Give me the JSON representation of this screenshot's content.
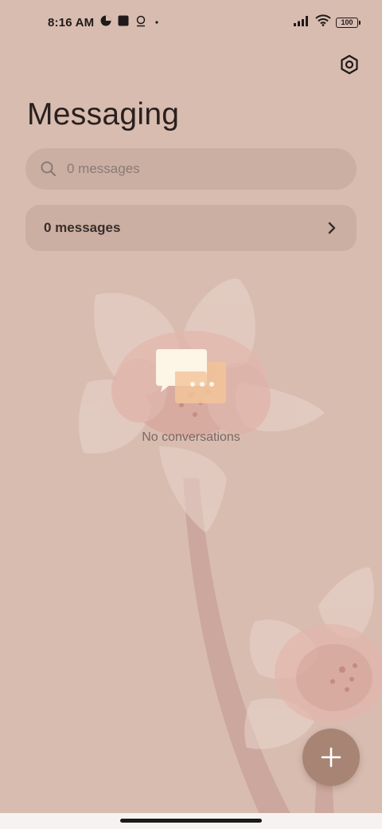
{
  "status_bar": {
    "time": "8:16 AM",
    "battery": "100",
    "icons": [
      "app-notification-icon",
      "square-notification-icon",
      "location-pin-icon",
      "more-dot-icon",
      "signal-icon",
      "wifi-icon",
      "battery-icon"
    ]
  },
  "header": {
    "title": "Messaging",
    "settings_icon": "settings-gear-icon"
  },
  "search": {
    "placeholder": "0 messages",
    "icon": "search-icon"
  },
  "messages_row": {
    "label": "0 messages",
    "icon": "chevron-right-icon"
  },
  "empty_state": {
    "icon": "chat-bubbles-icon",
    "text": "No conversations"
  },
  "fab": {
    "icon": "plus-icon"
  },
  "colors": {
    "background": "#d8bcb0",
    "fab": "#a88474",
    "text_primary": "#2a201e",
    "text_secondary": "#7c6762",
    "bubble_front": "#fdf5e6",
    "bubble_back": "#f2c49a"
  }
}
